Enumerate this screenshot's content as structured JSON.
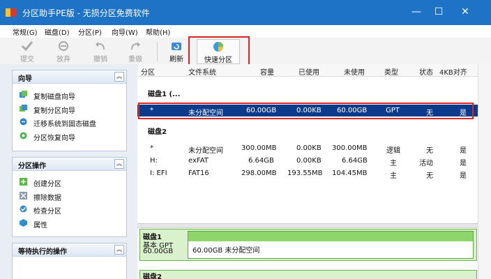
{
  "window": {
    "title": "分区助手PE版 - 无损分区免费软件",
    "controls": {
      "minimize": "—",
      "maximize": "☐",
      "close": "✕"
    }
  },
  "menu": [
    "常规(G)",
    "磁盘(D)",
    "分区(P)",
    "向导(W)",
    "帮助(H)"
  ],
  "toolbar": {
    "buttons": [
      {
        "label": "提交",
        "icon": "check-icon",
        "enabled": false
      },
      {
        "label": "放弃",
        "icon": "discard-icon",
        "enabled": false
      },
      {
        "label": "撤销",
        "icon": "undo-icon",
        "enabled": false
      },
      {
        "label": "重做",
        "icon": "redo-icon",
        "enabled": false
      },
      {
        "label": "刷新",
        "icon": "refresh-icon",
        "enabled": true
      },
      {
        "label": "快速分区",
        "icon": "quick-partition-icon",
        "enabled": true
      }
    ]
  },
  "sidebar": {
    "wizard": {
      "title": "向导",
      "collapse": "︽",
      "items": [
        {
          "label": "复制磁盘向导",
          "icon": "copy-disk-icon"
        },
        {
          "label": "复制分区向导",
          "icon": "copy-partition-icon"
        },
        {
          "label": "迁移系统到固态磁盘",
          "icon": "migrate-os-icon"
        },
        {
          "label": "分区恢复向导",
          "icon": "recovery-icon"
        }
      ]
    },
    "partition_ops": {
      "title": "分区操作",
      "collapse": "︽",
      "items": [
        {
          "label": "创建分区",
          "icon": "create-partition-icon"
        },
        {
          "label": "擦除数据",
          "icon": "wipe-data-icon"
        },
        {
          "label": "检查分区",
          "icon": "check-partition-icon"
        },
        {
          "label": "属性",
          "icon": "properties-icon"
        }
      ]
    },
    "pending": {
      "title": "等待执行的操作",
      "collapse": "︽"
    }
  },
  "table": {
    "headers": [
      "分区",
      "文件系统",
      "容量",
      "已使用",
      "未使用",
      "类型",
      "状态",
      "4KB对齐"
    ],
    "disks": [
      {
        "title": "磁盘1 (...",
        "rows": [
          {
            "partition": "*",
            "fs": "未分配空间",
            "capacity": "60.00GB",
            "used": "0.00KB",
            "unused": "60.00GB",
            "type": "GPT",
            "status": "无",
            "aligned": "是",
            "selected": true
          }
        ]
      },
      {
        "title": "磁盘2",
        "rows": [
          {
            "partition": "*",
            "fs": "未分配空间",
            "capacity": "300.00MB",
            "used": "0.00KB",
            "unused": "300.00MB",
            "type": "逻辑",
            "status": "无",
            "aligned": "是"
          },
          {
            "partition": "H:",
            "fs": "exFAT",
            "capacity": "6.64GB",
            "used": "0.00KB",
            "unused": "6.64GB",
            "type": "主",
            "status": "活动",
            "aligned": "是"
          },
          {
            "partition": "I: EFI",
            "fs": "FAT16",
            "capacity": "298.00MB",
            "used": "193.55MB",
            "unused": "104.45MB",
            "type": "主",
            "status": "无",
            "aligned": "是"
          }
        ]
      }
    ]
  },
  "disk_map": {
    "disk1": {
      "name": "磁盘1",
      "style": "基本 GPT",
      "size": "60.00GB",
      "bar_label": "60.00GB 未分配空间",
      "fill": 1.0
    },
    "disk2": {
      "name": "磁盘2"
    }
  },
  "colors": {
    "accent": "#1e73c7",
    "selection": "#0d3b8c",
    "highlight": "#e02424",
    "disk_fill": "#8ed56b"
  }
}
